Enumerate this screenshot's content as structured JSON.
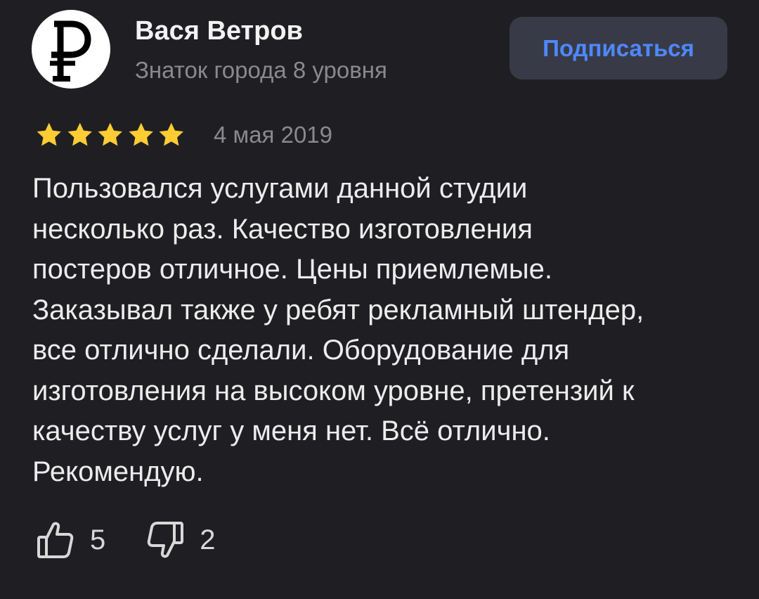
{
  "author": {
    "name": "Вася Ветров",
    "level": "Знаток города 8 уровня",
    "avatar_icon": "ruble-sign-icon"
  },
  "subscribe": {
    "label": "Подписаться"
  },
  "review": {
    "rating": 5,
    "max_rating": 5,
    "date": "4 мая 2019",
    "text_lines": [
      "Пользовался услугами данной студии",
      "несколько раз. Качество изготовления",
      "постеров отличное. Цены приемлемые.",
      "Заказывал также у ребят рекламный штендер,",
      "все отлично сделали. Оборудование для",
      "изготовления на высоком уровне, претензий к",
      "качеству услуг у меня нет. Всё отлично.",
      "Рекомендую."
    ]
  },
  "reactions": {
    "likes": "5",
    "dislikes": "2"
  },
  "colors": {
    "background": "#1f1f23",
    "star": "#ffcc33",
    "accent": "#4f87ff",
    "button_bg": "#383b47",
    "muted_text": "#8a8a8e"
  }
}
